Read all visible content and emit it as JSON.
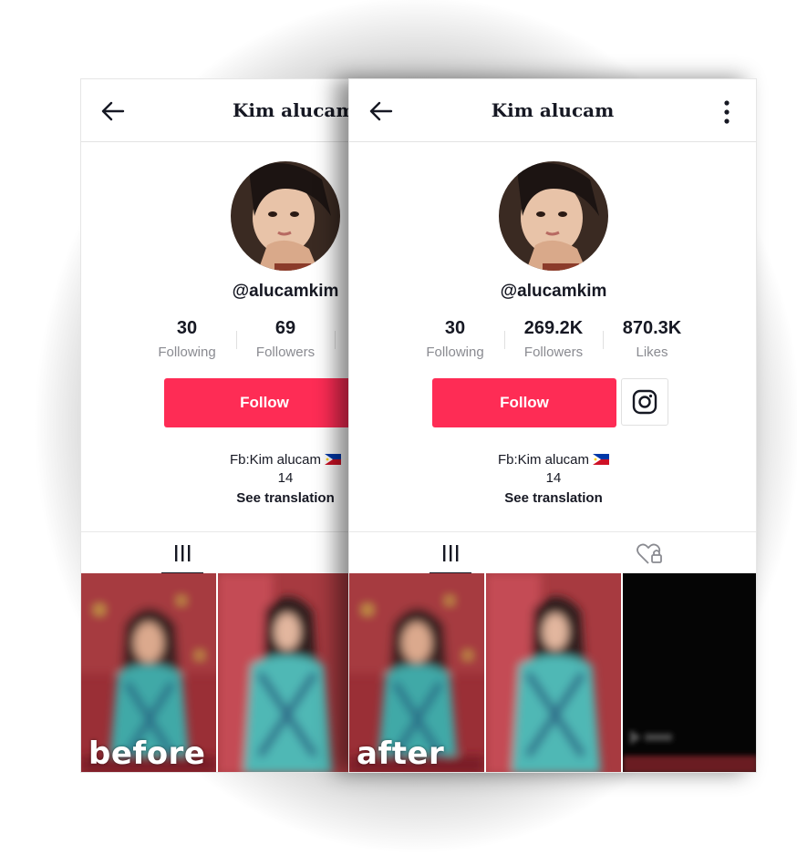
{
  "panels": [
    {
      "id": "before",
      "profile_title": "Kim alucam",
      "username": "@alucamkim",
      "stats": [
        {
          "value": "30",
          "label": "Following"
        },
        {
          "value": "69",
          "label": "Followers"
        }
      ],
      "follow_label": "Follow",
      "bio_line1": "Fb:Kim alucam",
      "bio_line2": "14",
      "see_translation": "See translation",
      "caption": "before"
    },
    {
      "id": "after",
      "profile_title": "Kim alucam",
      "username": "@alucamkim",
      "stats": [
        {
          "value": "30",
          "label": "Following"
        },
        {
          "value": "269.2K",
          "label": "Followers"
        },
        {
          "value": "870.3K",
          "label": "Likes"
        }
      ],
      "follow_label": "Follow",
      "bio_line1": "Fb:Kim alucam",
      "bio_line2": "14",
      "see_translation": "See translation",
      "caption": "after"
    }
  ],
  "icons": {
    "back": "arrow-left-icon",
    "more": "vertical-dots-icon",
    "instagram": "instagram-icon",
    "grid": "grid-icon",
    "liked": "heart-lock-icon",
    "flag": "philippines-flag-icon"
  },
  "colors": {
    "follow_button": "#fe2c55",
    "text_primary": "#161823",
    "text_secondary": "#8a8b91"
  }
}
